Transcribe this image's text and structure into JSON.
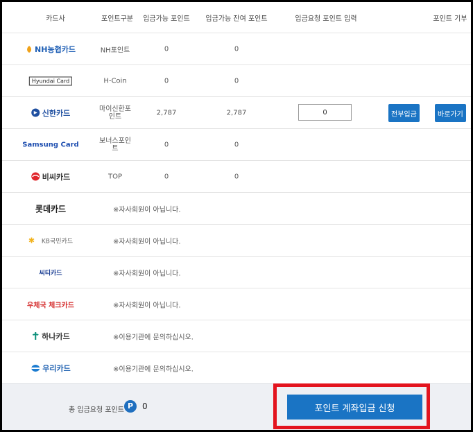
{
  "headers": {
    "card_company": "카드사",
    "point_type": "포인트구분",
    "available_points": "입금가능 포인트",
    "available_remaining": "입금가능 잔여 포인트",
    "request_input": "입금요청 포인트 입력",
    "donate": "포인트 기부"
  },
  "rows": [
    {
      "logo": "NH농협카드",
      "type": "NH포인트",
      "avail": "0",
      "remain": "0"
    },
    {
      "logo": "Hyundai Card",
      "type": "H-Coin",
      "avail": "0",
      "remain": "0"
    },
    {
      "logo": "신한카드",
      "type": "마이신한포인트",
      "avail": "2,787",
      "remain": "2,787",
      "input_value": "0",
      "all_btn": "전부입금",
      "go_btn": "바로가기"
    },
    {
      "logo": "Samsung Card",
      "type": "보너스포인트",
      "avail": "0",
      "remain": "0"
    },
    {
      "logo": "비씨카드",
      "type": "TOP",
      "avail": "0",
      "remain": "0"
    },
    {
      "logo": "롯데카드",
      "note": "※자사회원이 아닙니다."
    },
    {
      "logo": "KB국민카드",
      "note": "※자사회원이 아닙니다."
    },
    {
      "logo": "씨티카드",
      "note": "※자사회원이 아닙니다."
    },
    {
      "logo": "우체국 체크카드",
      "note": "※자사회원이 아닙니다."
    },
    {
      "logo": "하나카드",
      "note": "※이용기관에 문의하십시오."
    },
    {
      "logo": "우리카드",
      "note": "※이용기관에 문의하십시오."
    }
  ],
  "footer": {
    "total_label": "총 입금요청 포인트",
    "badge": "P",
    "total_value": "0",
    "apply_label": "포인트 계좌입금 신청"
  },
  "colors": {
    "accent": "#1a74c4",
    "highlight": "#e3141e"
  }
}
